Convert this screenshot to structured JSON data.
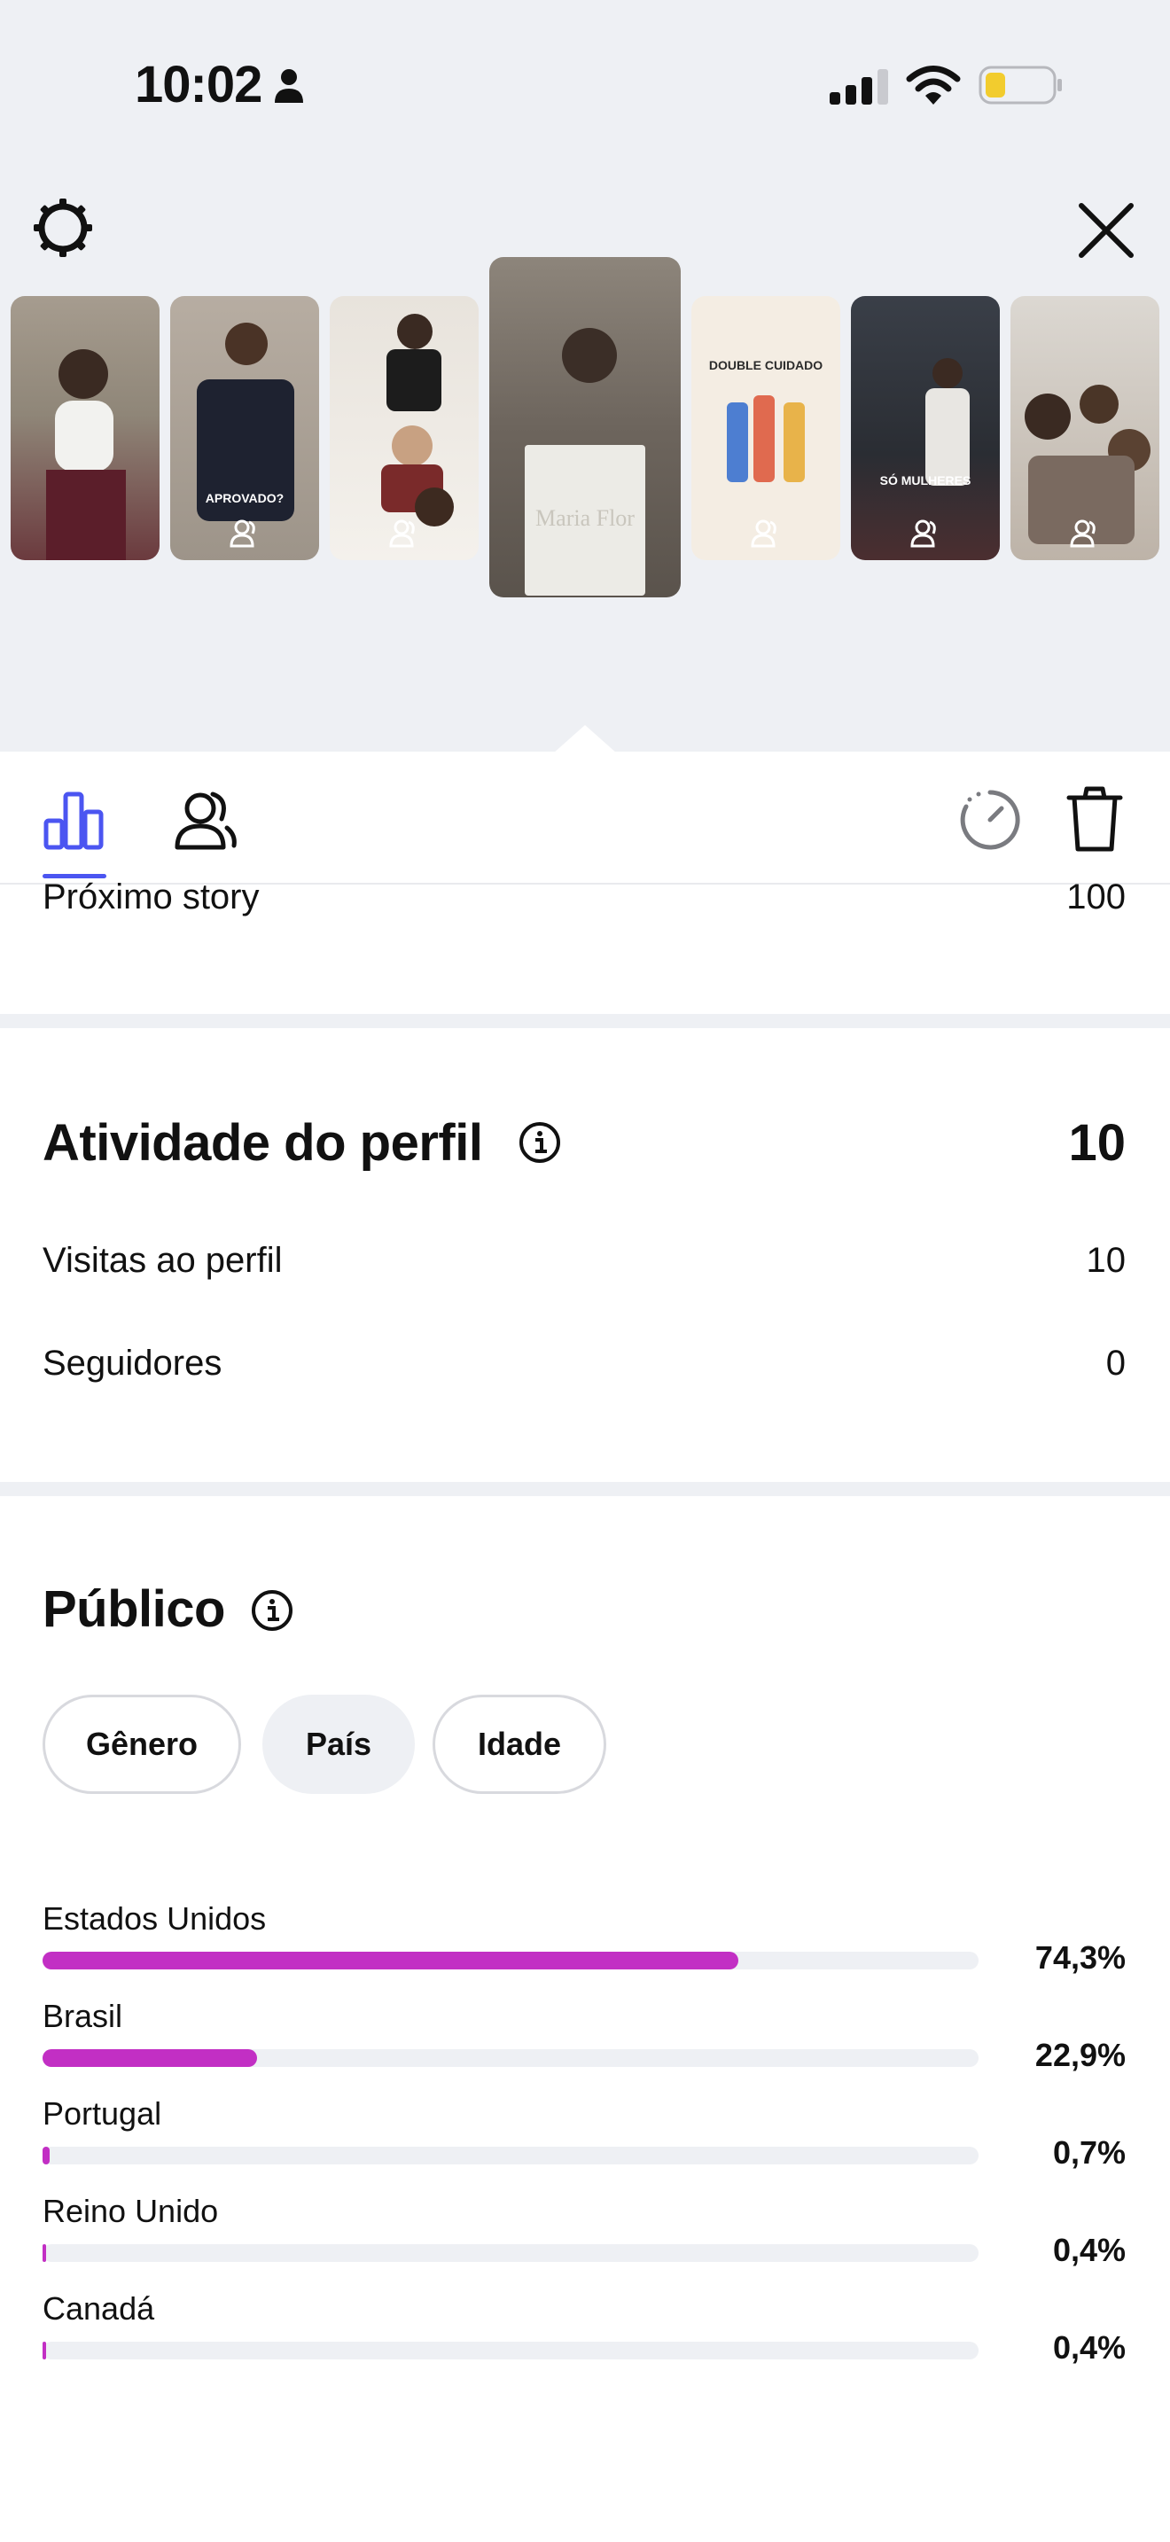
{
  "status_bar": {
    "time": "10:02"
  },
  "header": {
    "icons": {
      "settings": "gear-icon",
      "close": "close-icon"
    }
  },
  "thumbnails": [
    {
      "id": "story-1",
      "caption": ""
    },
    {
      "id": "story-2",
      "caption": "APROVADO?"
    },
    {
      "id": "story-3",
      "caption": ""
    },
    {
      "id": "story-4",
      "caption": "Maria Flor"
    },
    {
      "id": "story-5",
      "caption": "DOUBLE CUIDADO"
    },
    {
      "id": "story-6",
      "caption": "SÓ MULHERES"
    },
    {
      "id": "story-7",
      "caption": ""
    }
  ],
  "tabs": {
    "insights": "insights-bar-chart-icon",
    "audience": "people-icon",
    "timer": "timer-icon",
    "delete": "trash-icon"
  },
  "next_story": {
    "label": "Próximo story",
    "value": "100"
  },
  "profile_activity": {
    "title": "Atividade do perfil",
    "total": "10",
    "rows": [
      {
        "label": "Visitas ao perfil",
        "value": "10"
      },
      {
        "label": "Seguidores",
        "value": "0"
      }
    ]
  },
  "audience": {
    "title": "Público",
    "chips": [
      {
        "label": "Gênero",
        "selected": false
      },
      {
        "label": "País",
        "selected": true
      },
      {
        "label": "Idade",
        "selected": false
      }
    ],
    "accent_color": "#c22fc4",
    "countries": [
      {
        "name": "Estados Unidos",
        "percent_text": "74,3%",
        "fraction": 0.743
      },
      {
        "name": "Brasil",
        "percent_text": "22,9%",
        "fraction": 0.229
      },
      {
        "name": "Portugal",
        "percent_text": "0,7%",
        "fraction": 0.007
      },
      {
        "name": "Reino Unido",
        "percent_text": "0,4%",
        "fraction": 0.004
      },
      {
        "name": "Canadá",
        "percent_text": "0,4%",
        "fraction": 0.004
      }
    ]
  }
}
